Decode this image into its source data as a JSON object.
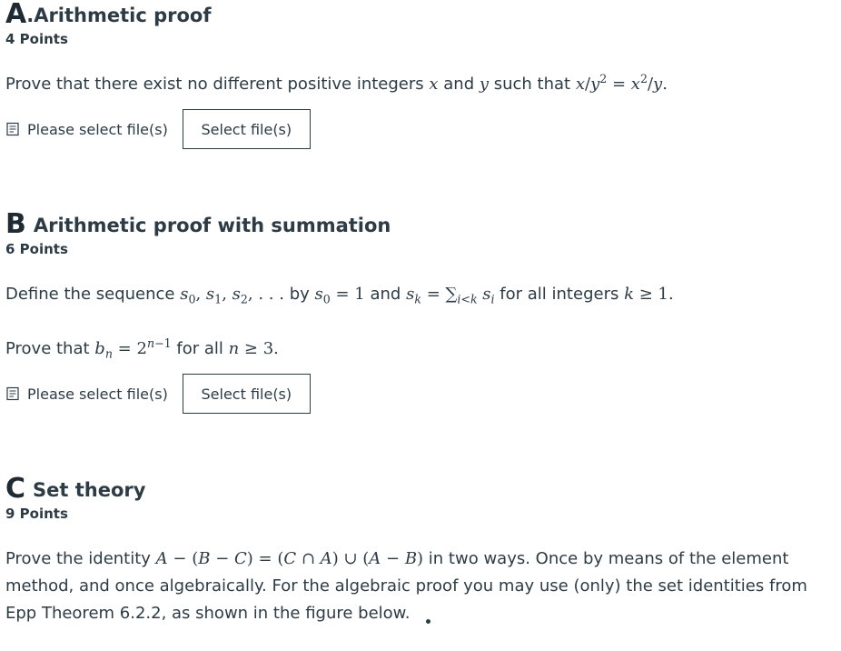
{
  "questions": {
    "a": {
      "letter": "A",
      "title": ".Arithmetic proof",
      "points": "4 Points",
      "text_before": "Prove that there exist no different positive integers ",
      "text_and": " and ",
      "text_after": " such that ",
      "upload_label": "Please select file(s)",
      "button_label": "Select file(s)"
    },
    "b": {
      "letter": "B",
      "title": "Arithmetic proof with summation",
      "points": "6 Points",
      "text1_define": "Define the sequence ",
      "text1_by": " by ",
      "text1_and": " and ",
      "text1_forall": " for all integers ",
      "text2_prove": "Prove that ",
      "text2_forall": " for all ",
      "upload_label": "Please select file(s)",
      "button_label": "Select file(s)"
    },
    "c": {
      "letter": "C",
      "title": "Set theory",
      "points": "9 Points",
      "text_prove": "Prove the identity ",
      "text_rest": " in two ways. Once by means of the element method, and once algebraically. For the algebraic proof you may use (only) the set identities from Epp Theorem 6.2.2, as shown in the figure below."
    }
  },
  "icons": {
    "upload": "file-document-icon"
  }
}
